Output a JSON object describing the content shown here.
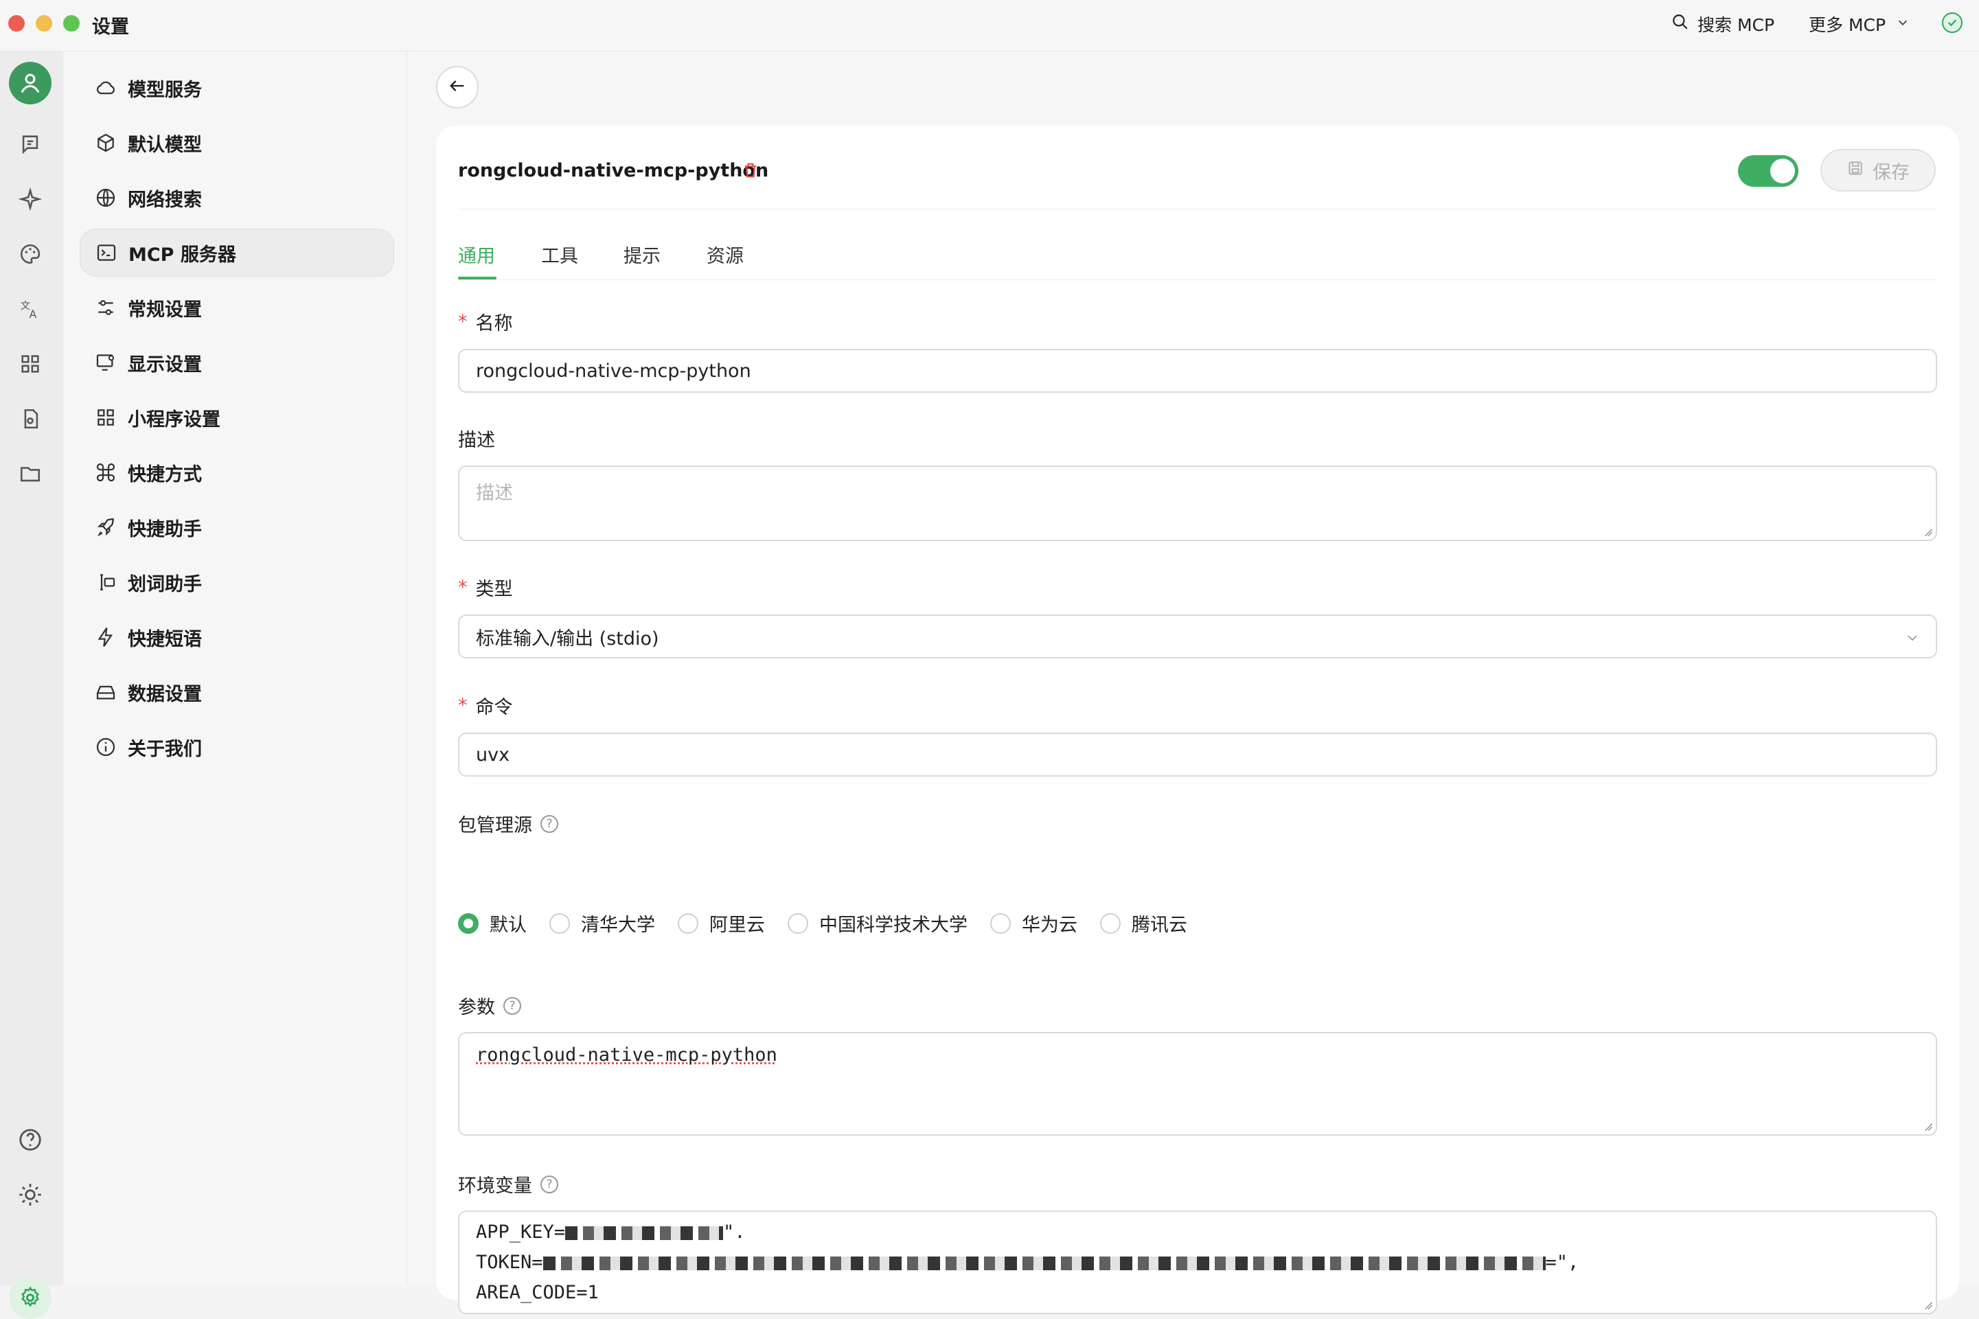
{
  "window": {
    "title": "设置",
    "search_mcp": "搜索 MCP",
    "more_mcp": "更多 MCP"
  },
  "sidebar": {
    "items": [
      {
        "label": "模型服务",
        "icon": "cloud-icon"
      },
      {
        "label": "默认模型",
        "icon": "cube-icon"
      },
      {
        "label": "网络搜索",
        "icon": "globe-icon"
      },
      {
        "label": "MCP 服务器",
        "icon": "terminal-icon"
      },
      {
        "label": "常规设置",
        "icon": "sliders-icon"
      },
      {
        "label": "显示设置",
        "icon": "monitor-settings-icon"
      },
      {
        "label": "小程序设置",
        "icon": "grid-icon"
      },
      {
        "label": "快捷方式",
        "icon": "command-icon"
      },
      {
        "label": "快捷助手",
        "icon": "rocket-icon"
      },
      {
        "label": "划词助手",
        "icon": "text-select-icon"
      },
      {
        "label": "快捷短语",
        "icon": "lightning-icon"
      },
      {
        "label": "数据设置",
        "icon": "storage-icon"
      },
      {
        "label": "关于我们",
        "icon": "info-icon"
      }
    ]
  },
  "server": {
    "name": "rongcloud-native-mcp-python",
    "save_label": "保存",
    "enabled": true
  },
  "tabs": [
    "通用",
    "工具",
    "提示",
    "资源"
  ],
  "form": {
    "name_label": "名称",
    "name_value": "rongcloud-native-mcp-python",
    "description_label": "描述",
    "description_placeholder": "描述",
    "type_label": "类型",
    "type_value": "标准输入/输出 (stdio)",
    "command_label": "命令",
    "command_value": "uvx",
    "registry_label": "包管理源",
    "registry_options": [
      "默认",
      "清华大学",
      "阿里云",
      "中国科学技术大学",
      "华为云",
      "腾讯云"
    ],
    "params_label": "参数",
    "params_value": "rongcloud-native-mcp-python",
    "env_label": "环境变量",
    "env_lines": {
      "app_key_prefix": "APP_KEY=",
      "app_key_suffix": "\".",
      "token_prefix": "TOKEN=",
      "token_suffix": "=\",",
      "area_code": "AREA_CODE=1"
    }
  },
  "colors": {
    "accent": "#3fae62",
    "required": "#e54a4a"
  }
}
